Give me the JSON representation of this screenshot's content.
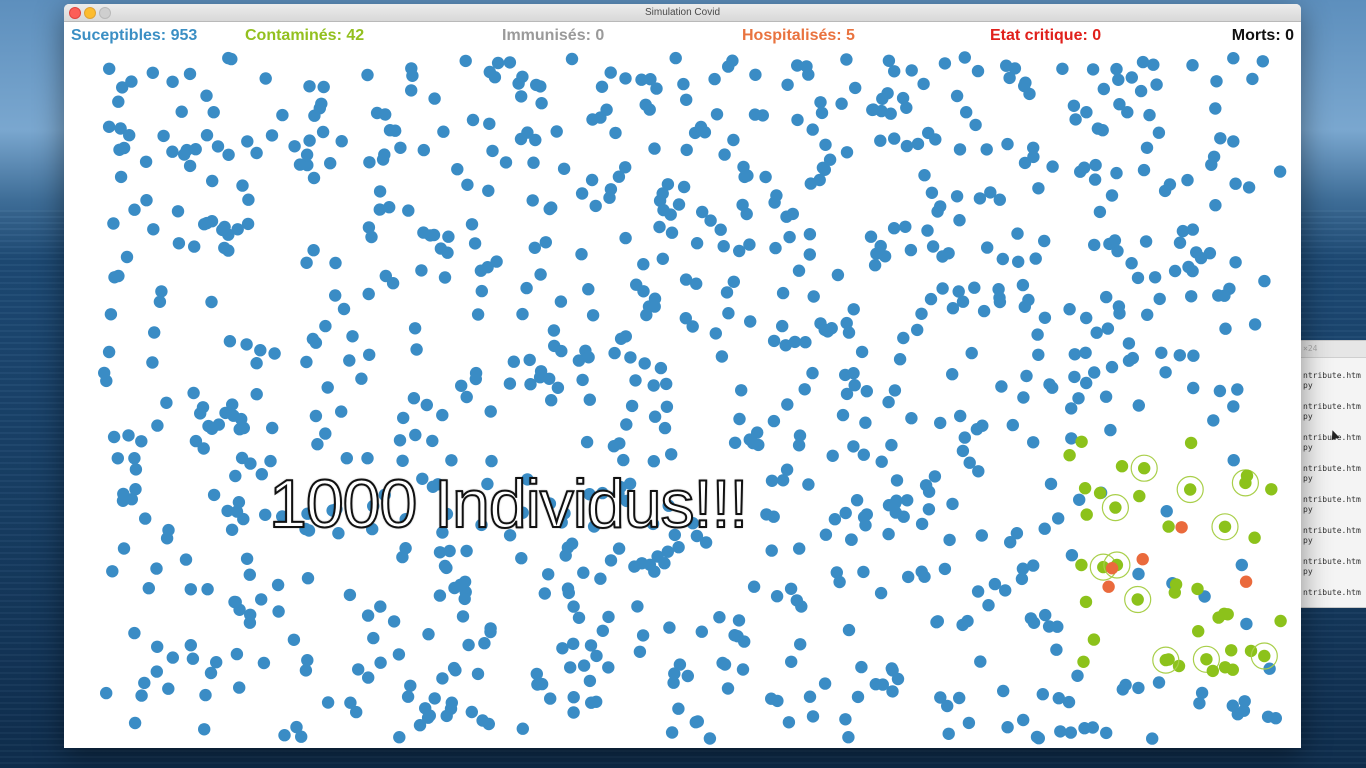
{
  "window": {
    "title": "Simulation Covid"
  },
  "stats": [
    {
      "key": "susceptible",
      "label": "Suceptibles: ",
      "value": "953",
      "color": "#3b8fc4"
    },
    {
      "key": "contaminated",
      "label": "Contaminés: ",
      "value": "42",
      "color": "#93c01f"
    },
    {
      "key": "immune",
      "label": "Immunisés: ",
      "value": "0",
      "color": "#9a9a9a"
    },
    {
      "key": "hospitalized",
      "label": "Hospitalisés: ",
      "value": "5",
      "color": "#e9733f"
    },
    {
      "key": "critical",
      "label": "Etat critique: ",
      "value": "0",
      "color": "#e0201b"
    },
    {
      "key": "dead",
      "label": "Morts: ",
      "value": "0",
      "color": "#111111"
    }
  ],
  "overlay": {
    "caption": "1000 Individus!!!"
  },
  "population": {
    "total": 1000,
    "susceptible": 953,
    "contaminated": 42,
    "immune": 0,
    "hospitalized": 5,
    "critical": 0,
    "dead": 0
  },
  "colors": {
    "susceptible": "#3a8cc5",
    "contaminated": "#8cc21b",
    "hospitalized": "#ea6a3c",
    "contagion_ring": "#a9cf4a"
  },
  "background_terminal": {
    "title": "×24",
    "lines": [
      "ntribute.htm\npy",
      "ntribute.htm\npy",
      "ntribute.htm\npy",
      "ntribute.htm\npy",
      "ntribute.htm\npy",
      "ntribute.htm\npy",
      "ntribute.htm\npy",
      "ntribute.htm"
    ]
  }
}
